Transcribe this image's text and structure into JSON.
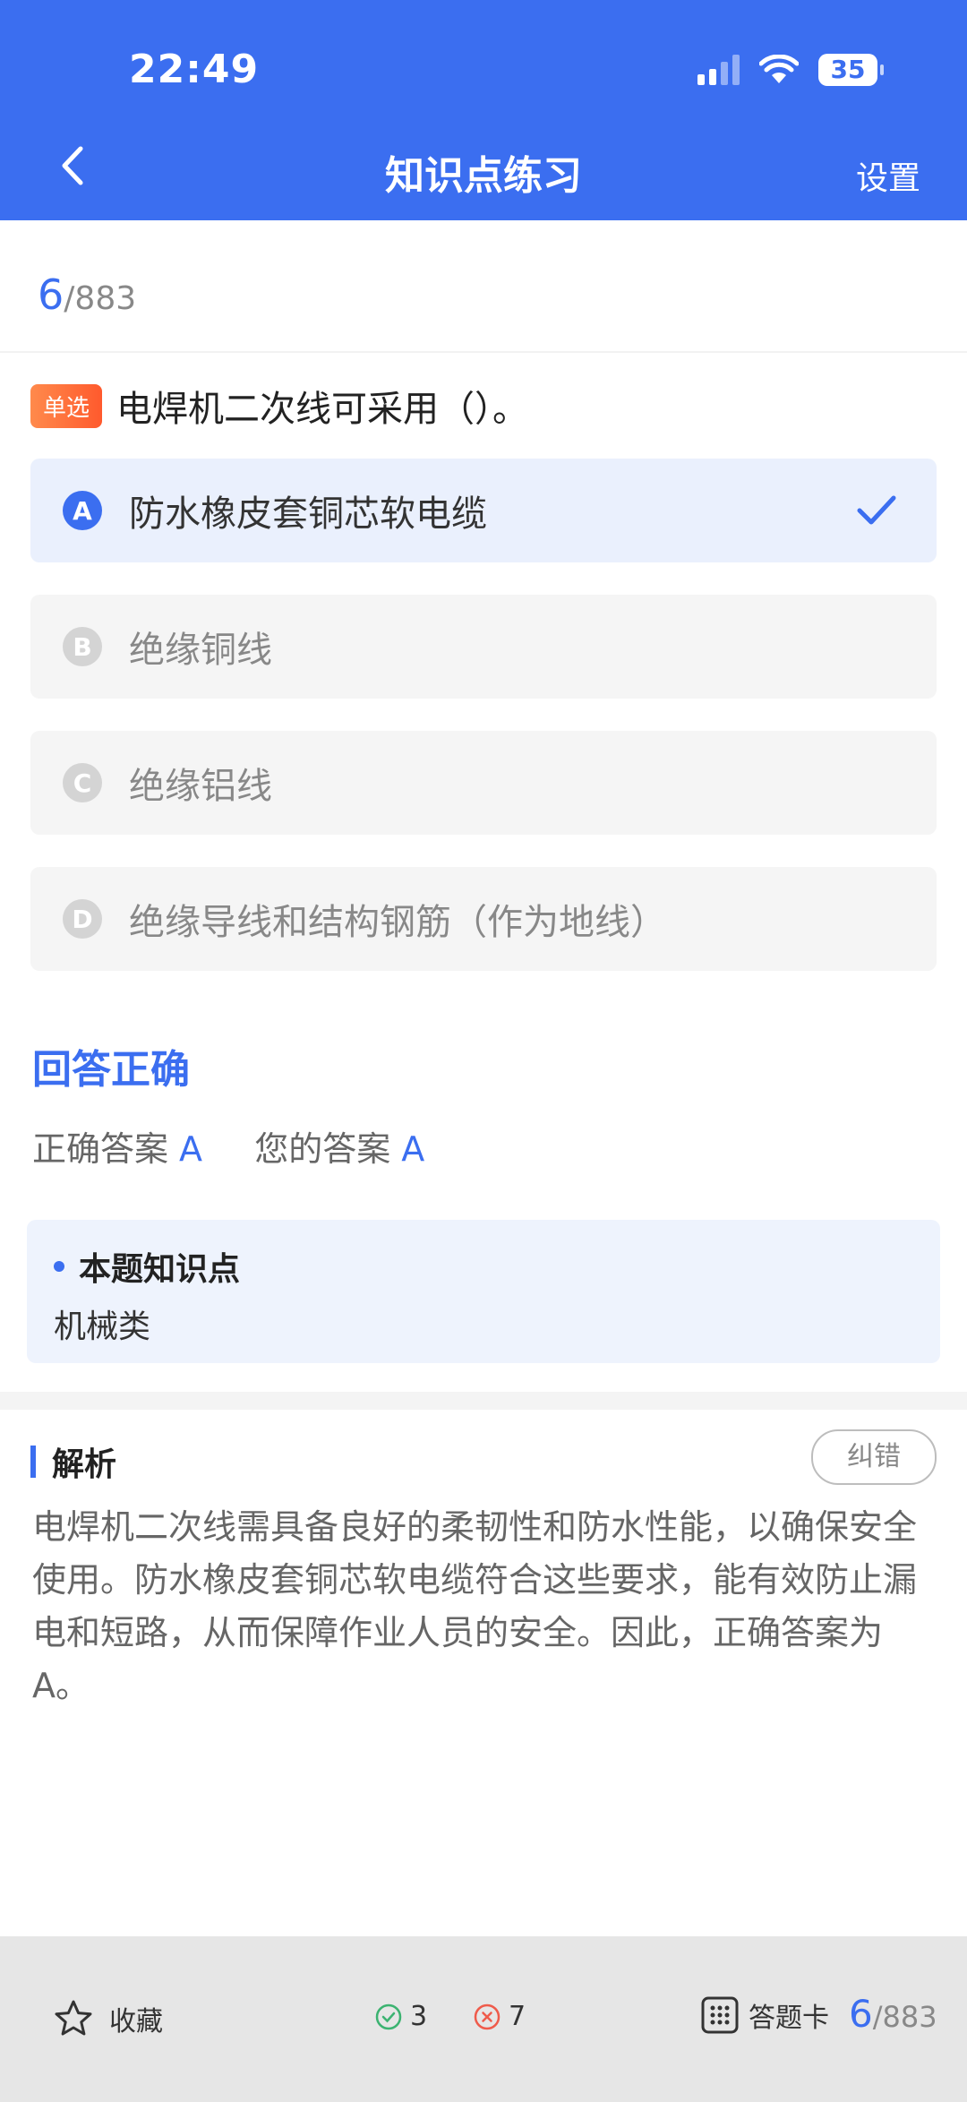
{
  "status": {
    "time": "22:49",
    "battery": "35"
  },
  "header": {
    "title": "知识点练习",
    "settings": "设置"
  },
  "progress": {
    "current": "6",
    "total": "/883"
  },
  "question": {
    "type": "单选",
    "text": "电焊机二次线可采用（）。",
    "options": [
      {
        "letter": "A",
        "text": "防水橡皮套铜芯软电缆",
        "selected": true
      },
      {
        "letter": "B",
        "text": "绝缘铜线",
        "selected": false
      },
      {
        "letter": "C",
        "text": "绝缘铝线",
        "selected": false
      },
      {
        "letter": "D",
        "text": "绝缘导线和结构钢筋（作为地线）",
        "selected": false
      }
    ]
  },
  "result": {
    "title": "回答正确",
    "correct_label": "正确答案",
    "correct_value": "A",
    "your_label": "您的答案",
    "your_value": "A"
  },
  "knowledge": {
    "title": "本题知识点",
    "value": "机械类"
  },
  "analysis": {
    "title": "解析",
    "correction": "纠错",
    "text": "电焊机二次线需具备良好的柔韧性和防水性能，以确保安全使用。防水橡皮套铜芯软电缆符合这些要求，能有效防止漏电和短路，从而保障作业人员的安全。因此，正确答案为A。"
  },
  "bottom": {
    "favorite": "收藏",
    "right_count": "3",
    "wrong_count": "7",
    "answer_card": "答题卡",
    "current": "6",
    "total": "/883"
  },
  "colors": {
    "accent": "#3b6ef0",
    "tag": "#ff6a3a",
    "right": "#3cb371",
    "wrong": "#ef5b4b"
  }
}
